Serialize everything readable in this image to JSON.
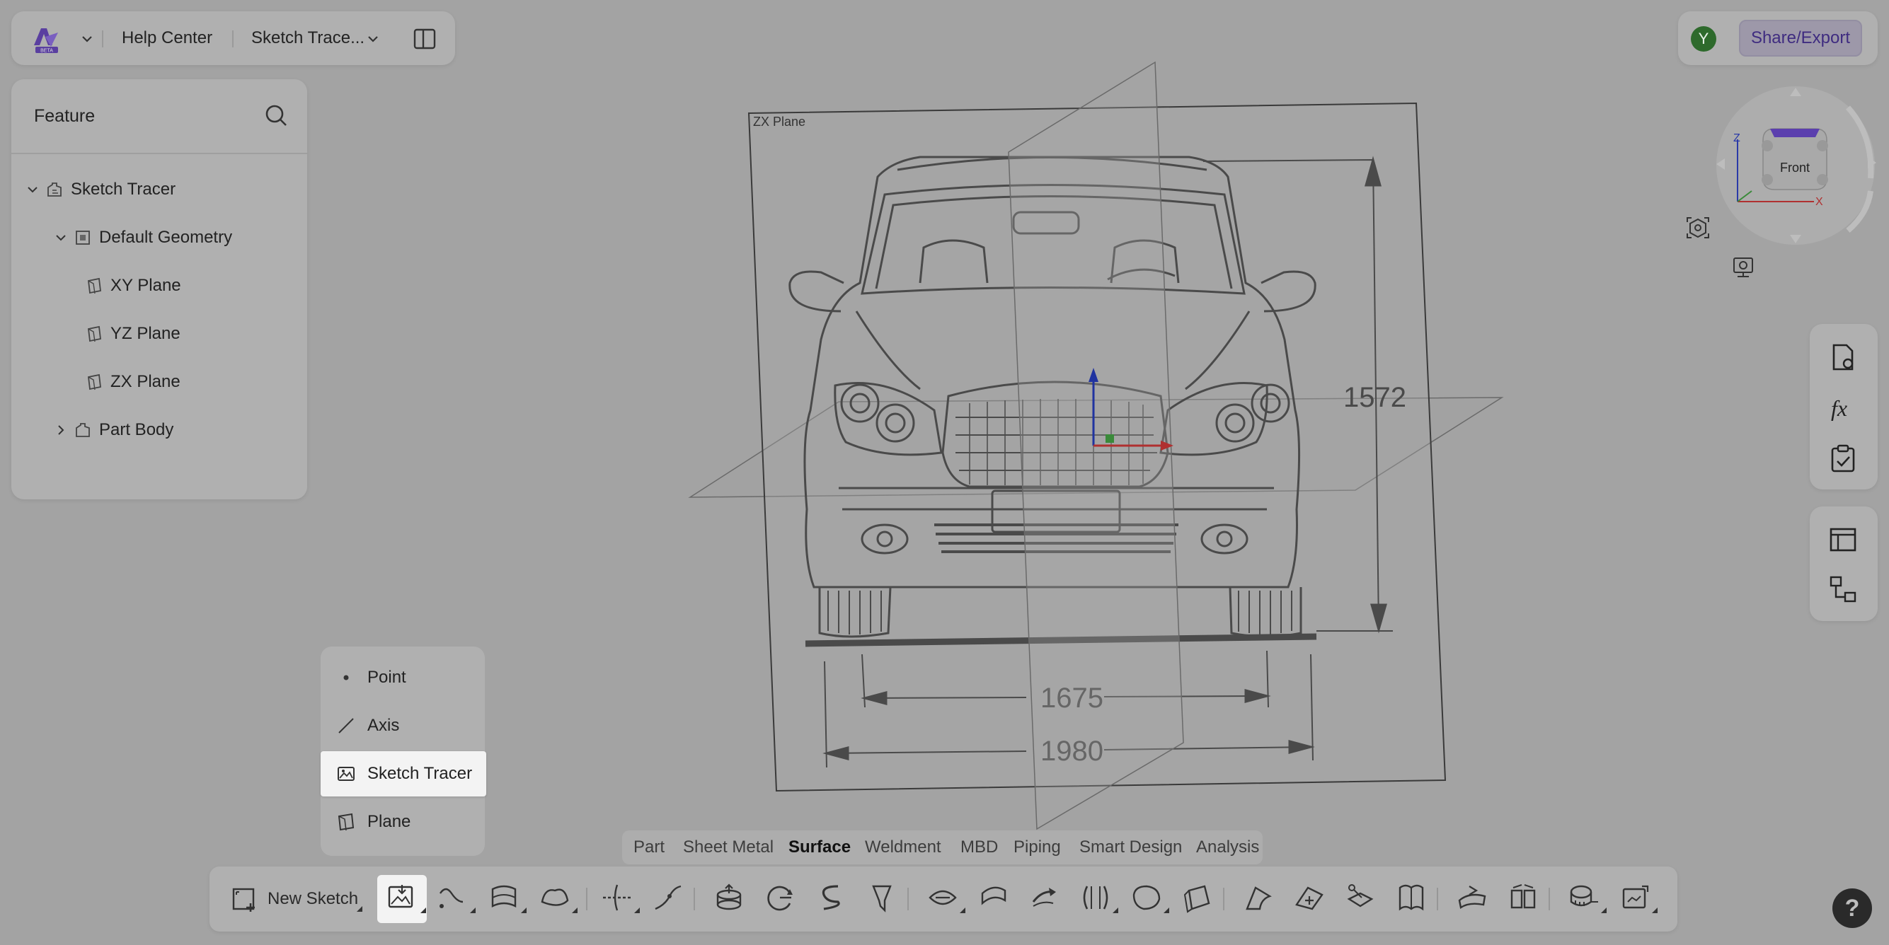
{
  "topbar": {
    "logo_badge": "BETA",
    "help_center": "Help Center",
    "document_name": "Sketch Trace..."
  },
  "account": {
    "avatar_initial": "Y",
    "share_label": "Share/Export"
  },
  "feature_panel": {
    "title": "Feature",
    "tree": [
      {
        "label": "Sketch Tracer",
        "expanded": true,
        "level": 0,
        "icon": "part-icon"
      },
      {
        "label": "Default Geometry",
        "expanded": true,
        "level": 1,
        "icon": "geometry-icon"
      },
      {
        "label": "XY Plane",
        "level": 2,
        "icon": "plane-icon"
      },
      {
        "label": "YZ Plane",
        "level": 2,
        "icon": "plane-icon"
      },
      {
        "label": "ZX Plane",
        "level": 2,
        "icon": "plane-icon"
      },
      {
        "label": "Part Body",
        "expanded": false,
        "level": 1,
        "icon": "body-icon"
      }
    ]
  },
  "viewport": {
    "plane_label": "ZX Plane",
    "dim_height": "1572",
    "dim_track": "1675",
    "dim_width": "1980"
  },
  "view_cube": {
    "face": "Front",
    "axis_z": "Z",
    "axis_x": "X"
  },
  "reference_menu": {
    "items": [
      {
        "label": "Point",
        "icon": "point-icon"
      },
      {
        "label": "Axis",
        "icon": "axis-icon"
      },
      {
        "label": "Sketch Tracer",
        "icon": "sketch-tracer-icon",
        "active": true
      },
      {
        "label": "Plane",
        "icon": "plane-icon"
      }
    ]
  },
  "mode_tabs": {
    "items": [
      "Part",
      "Sheet Metal",
      "Surface",
      "Weldment",
      "MBD",
      "Piping",
      "Smart Design",
      "Analysis"
    ],
    "active": "Surface"
  },
  "toolbar": {
    "new_sketch_label": "New Sketch"
  },
  "help_label": "?"
}
